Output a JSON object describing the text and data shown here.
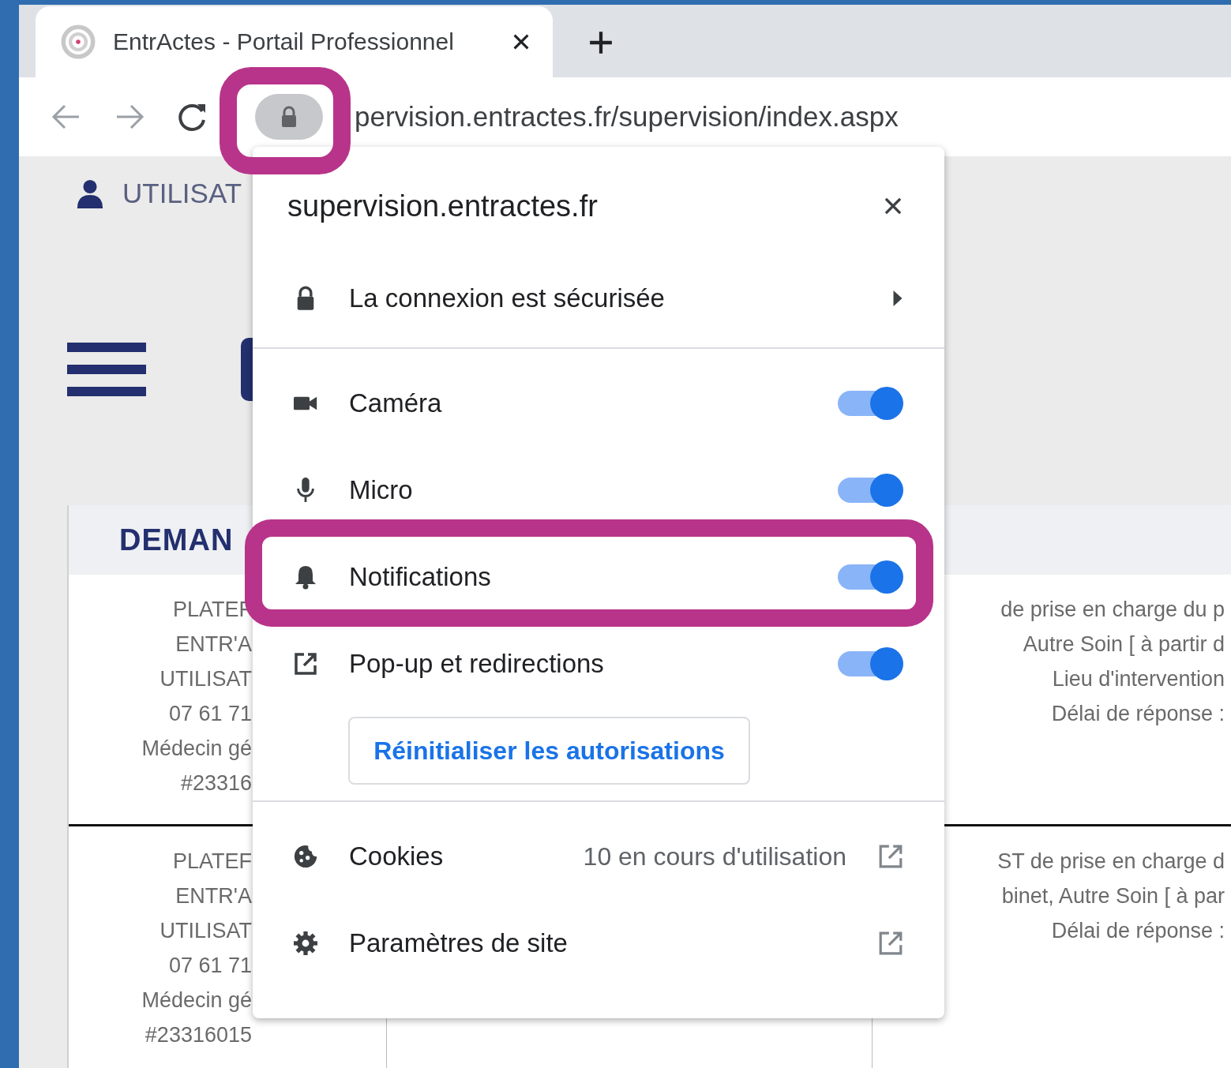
{
  "browser": {
    "tab": {
      "title": "EntrActes - Portail Professionnel",
      "selected": true
    },
    "address": "pervision.entractes.fr/supervision/index.aspx"
  },
  "page": {
    "user_label": "UTILISAT",
    "panel_title": "DEMAN",
    "rows": [
      {
        "column_1": [
          "PLATEF",
          "ENTR'A",
          "UTILISAT",
          "07 61 71",
          "Médecin gé",
          "#23316"
        ],
        "column_3": [
          "de prise en charge du p",
          "Autre Soin [ à partir d",
          "Lieu d'intervention",
          "Délai de réponse :"
        ]
      },
      {
        "column_1": [
          "PLATEF",
          "ENTR'A",
          "UTILISAT",
          "07 61 71",
          "Médecin gé",
          "#23316015"
        ],
        "column_3": [
          "ST de prise en charge d",
          "binet, Autre Soin [ à par",
          "Délai de réponse :"
        ]
      }
    ]
  },
  "site_info": {
    "domain": "supervision.entractes.fr",
    "connection": "La connexion est sécurisée",
    "permissions": [
      {
        "kind": "camera",
        "label": "Caméra",
        "on": true
      },
      {
        "kind": "micro",
        "label": "Micro",
        "on": true
      },
      {
        "kind": "notifications",
        "label": "Notifications",
        "on": true
      },
      {
        "kind": "popups",
        "label": "Pop-up et redirections",
        "on": true
      }
    ],
    "reset_button": "Réinitialiser les autorisations",
    "cookies": {
      "label": "Cookies",
      "count": "10 en cours d'utilisation"
    },
    "site_settings": "Paramètres de site"
  }
}
